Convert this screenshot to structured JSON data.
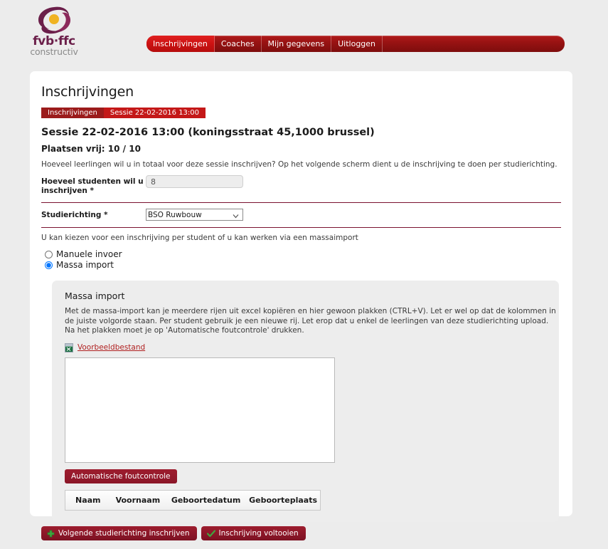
{
  "brand": {
    "wordmark": "fvb·ffc",
    "subtitle": "constructiv",
    "logo_colors": {
      "swirl": "#6b1f4a",
      "dot": "#f0b323"
    }
  },
  "nav": {
    "items": [
      {
        "label": "Inschrijvingen",
        "active": true
      },
      {
        "label": "Coaches",
        "active": false
      },
      {
        "label": "Mijn gegevens",
        "active": false
      },
      {
        "label": "Uitloggen",
        "active": false
      }
    ],
    "colors": {
      "bar": "#961212",
      "active": "#cc1212"
    }
  },
  "page": {
    "title": "Inschrijvingen",
    "breadcrumb": [
      "Inschrijvingen",
      "Sessie 22-02-2016 13:00"
    ],
    "session_title": "Sessie 22-02-2016 13:00 (koningsstraat 45,1000 brussel)",
    "places_free": "Plaatsen vrij: 10 / 10",
    "intro_text": "Hoeveel leerlingen wil u in totaal voor deze sessie inschrijven? Op het volgende scherm dient u de inschrijving te doen per studierichting."
  },
  "form": {
    "students_label": "Hoeveel studenten wil u inschrijven *",
    "students_value": "8",
    "students_placeholder": "",
    "studierichting_label": "Studierichting *",
    "studierichting_value": "BSO Ruwbouw",
    "studierichting_options": [
      "BSO Ruwbouw"
    ]
  },
  "choice": {
    "text": "U kan kiezen voor een inschrijving per student of u kan werken via een massaimport",
    "options": [
      {
        "label": "Manuele invoer",
        "selected": false
      },
      {
        "label": "Massa import",
        "selected": true
      }
    ]
  },
  "massa": {
    "title": "Massa import",
    "description": "Met de massa-import kan je meerdere rijen uit excel kopiëren en hier gewoon plakken (CTRL+V). Let er wel op dat de kolommen in de juiste volgorde staan. Per student gebruik je een nieuwe rij. Let erop dat u enkel de leerlingen van deze studierichting upload. Na het plakken moet je op 'Automatische foutcontrole' drukken.",
    "sample_link": "Voorbeeldbestand",
    "sample_icon": "excel-file-icon",
    "paste_value": "",
    "paste_placeholder": "",
    "check_button": "Automatische foutcontrole",
    "table_headers": [
      "Naam",
      "Voornaam",
      "Geboortedatum",
      "Geboorteplaats"
    ],
    "table_rows": []
  },
  "footer": {
    "buttons": [
      {
        "label": "Volgende studierichting inschrijven",
        "icon": "plus-icon"
      },
      {
        "label": "Inschrijving voltooien",
        "icon": "check-icon"
      }
    ]
  }
}
